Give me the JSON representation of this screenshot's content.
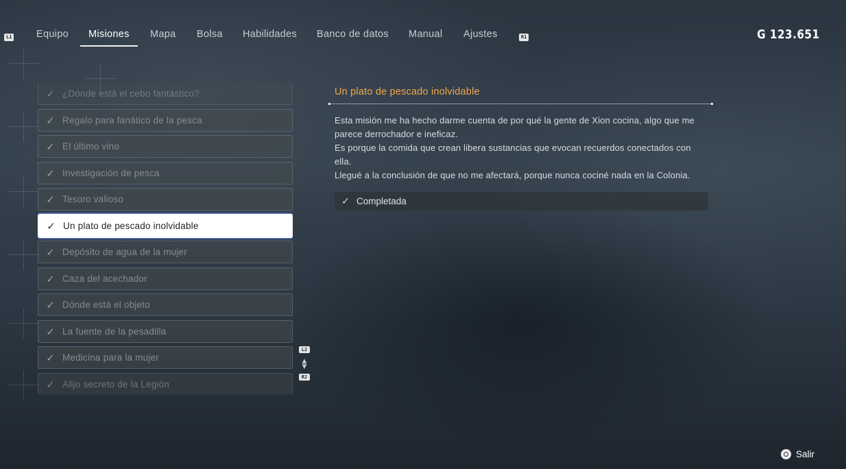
{
  "nav": {
    "left_button": "L1",
    "right_button": "R1",
    "tabs": [
      {
        "label": "Equipo"
      },
      {
        "label": "Misiones"
      },
      {
        "label": "Mapa"
      },
      {
        "label": "Bolsa"
      },
      {
        "label": "Habilidades"
      },
      {
        "label": "Banco de datos"
      },
      {
        "label": "Manual"
      },
      {
        "label": "Ajustes"
      }
    ],
    "active_tab": "Misiones",
    "currency_symbol": "G",
    "currency_amount": "123.651"
  },
  "missions": {
    "items": [
      {
        "label": "¿Dónde está el cebo fantástico?",
        "completed": true
      },
      {
        "label": "Regalo para fanático de la pesca",
        "completed": true
      },
      {
        "label": "El último vino",
        "completed": true
      },
      {
        "label": "Investigación de pesca",
        "completed": true
      },
      {
        "label": "Tesoro valioso",
        "completed": true
      },
      {
        "label": "Un plato de pescado inolvidable",
        "completed": true,
        "selected": true
      },
      {
        "label": "Depósito de agua de la mujer",
        "completed": true
      },
      {
        "label": "Caza del acechador",
        "completed": true
      },
      {
        "label": "Dónde está el objeto",
        "completed": true
      },
      {
        "label": "La fuente de la pesadilla",
        "completed": true
      },
      {
        "label": "Medicina para la mujer",
        "completed": true
      },
      {
        "label": "Alijo secreto de la Legión",
        "completed": true
      }
    ],
    "scroll_up_button": "L2",
    "scroll_down_button": "R2"
  },
  "detail": {
    "title": "Un plato de pescado inolvidable",
    "paragraphs": [
      "Esta misión me ha hecho darme cuenta de por qué la gente de Xion cocina, algo que me parece derrochador e ineficaz.",
      "Es porque la comida que crean libera sustancias que evocan recuerdos conectados con ella.",
      "Llegué a la conclusión de que no me afectará, porque nunca cociné nada en la Colonia."
    ],
    "status": "Completada"
  },
  "footer": {
    "exit_label": "Salir"
  },
  "colors": {
    "accent": "#f3a64a",
    "selected_bg": "#ffffff"
  }
}
